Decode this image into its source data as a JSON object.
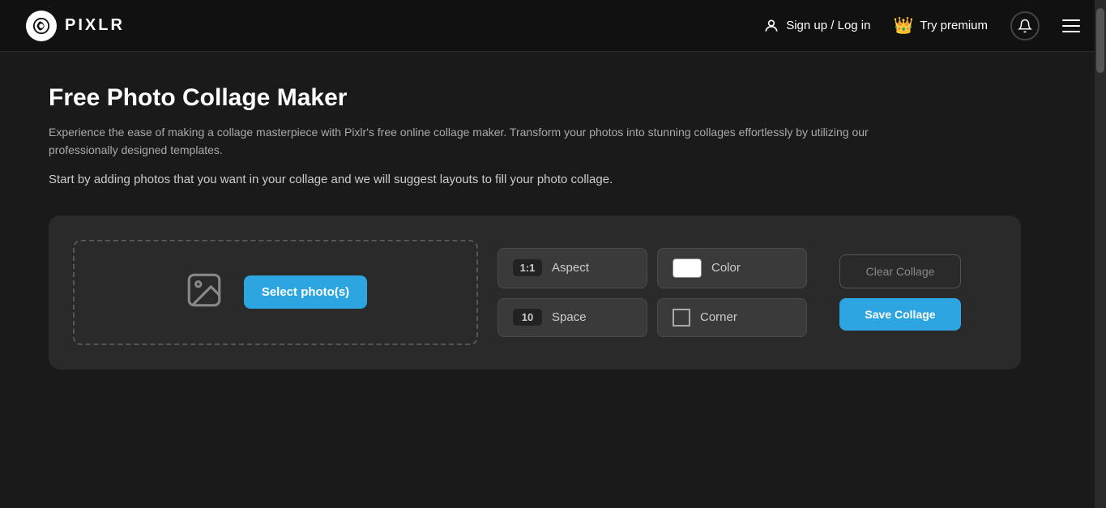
{
  "navbar": {
    "logo_text": "PIXLR",
    "signup_label": "Sign up / Log in",
    "premium_label": "Try premium"
  },
  "page": {
    "title": "Free Photo Collage Maker",
    "description": "Experience the ease of making a collage masterpiece with Pixlr's free online collage maker. Transform your photos into stunning collages effortlessly by utilizing our professionally designed templates.",
    "tagline": "Start by adding photos that you want in your collage and we will suggest layouts to fill your photo collage."
  },
  "upload": {
    "select_label": "Select photo(s)"
  },
  "controls": {
    "aspect": {
      "badge": "1:1",
      "label": "Aspect"
    },
    "color": {
      "label": "Color"
    },
    "space": {
      "badge": "10",
      "label": "Space"
    },
    "corner": {
      "label": "Corner"
    }
  },
  "actions": {
    "clear_label": "Clear Collage",
    "save_label": "Save Collage"
  }
}
